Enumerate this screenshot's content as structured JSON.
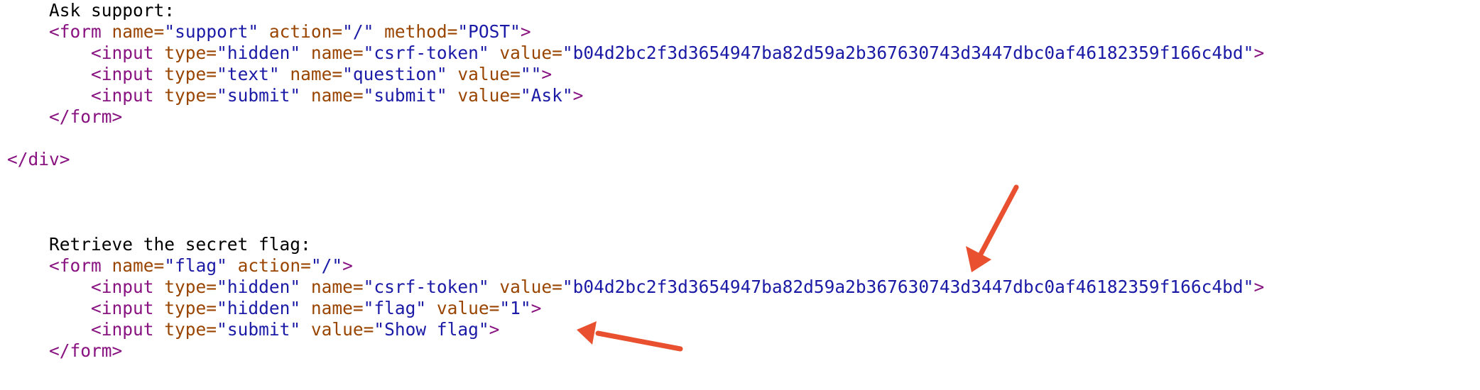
{
  "source": {
    "support_label": "Ask support:",
    "support_form_open": {
      "open": "<form",
      "a1_name": "name=",
      "a1_value": "\"support\"",
      "a2_name": "action=",
      "a2_value": "\"/\"",
      "a3_name": "method=",
      "a3_value": "\"POST\"",
      "close": ">"
    },
    "support_input_csrf": {
      "open": "<input",
      "a1_name": "type=",
      "a1_value": "\"hidden\"",
      "a2_name": "name=",
      "a2_value": "\"csrf-token\"",
      "a3_name": "value=",
      "a3_value": "\"b04d2bc2f3d3654947ba82d59a2b367630743d3447dbc0af46182359f166c4bd\"",
      "close": ">"
    },
    "support_input_question": {
      "open": "<input",
      "a1_name": "type=",
      "a1_value": "\"text\"",
      "a2_name": "name=",
      "a2_value": "\"question\"",
      "a3_name": "value=",
      "a3_value": "\"\"",
      "close": ">"
    },
    "support_input_submit": {
      "open": "<input",
      "a1_name": "type=",
      "a1_value": "\"submit\"",
      "a2_name": "name=",
      "a2_value": "\"submit\"",
      "a3_name": "value=",
      "a3_value": "\"Ask\"",
      "close": ">"
    },
    "support_form_close": "</form>",
    "div_close": "</div>",
    "flag_label": "Retrieve the secret flag:",
    "flag_form_open": {
      "open": "<form",
      "a1_name": "name=",
      "a1_value": "\"flag\"",
      "a2_name": "action=",
      "a2_value": "\"/\"",
      "close": ">"
    },
    "flag_input_csrf": {
      "open": "<input",
      "a1_name": "type=",
      "a1_value": "\"hidden\"",
      "a2_name": "name=",
      "a2_value": "\"csrf-token\"",
      "a3_name": "value=",
      "a3_value": "\"b04d2bc2f3d3654947ba82d59a2b367630743d3447dbc0af46182359f166c4bd\"",
      "close": ">"
    },
    "flag_input_flag": {
      "open": "<input",
      "a1_name": "type=",
      "a1_value": "\"hidden\"",
      "a2_name": "name=",
      "a2_value": "\"flag\"",
      "a3_name": "value=",
      "a3_value": "\"1\"",
      "close": ">"
    },
    "flag_input_submit": {
      "open": "<input",
      "a1_name": "type=",
      "a1_value": "\"submit\"",
      "a2_name": "value=",
      "a2_value": "\"Show flag\"",
      "close": ">"
    },
    "flag_form_close": "</form>"
  },
  "colors": {
    "tag": "#881280",
    "attribute_name": "#994500",
    "attribute_value": "#1a1aa6",
    "text": "#000000",
    "annotation_arrow": "#e9502f"
  }
}
